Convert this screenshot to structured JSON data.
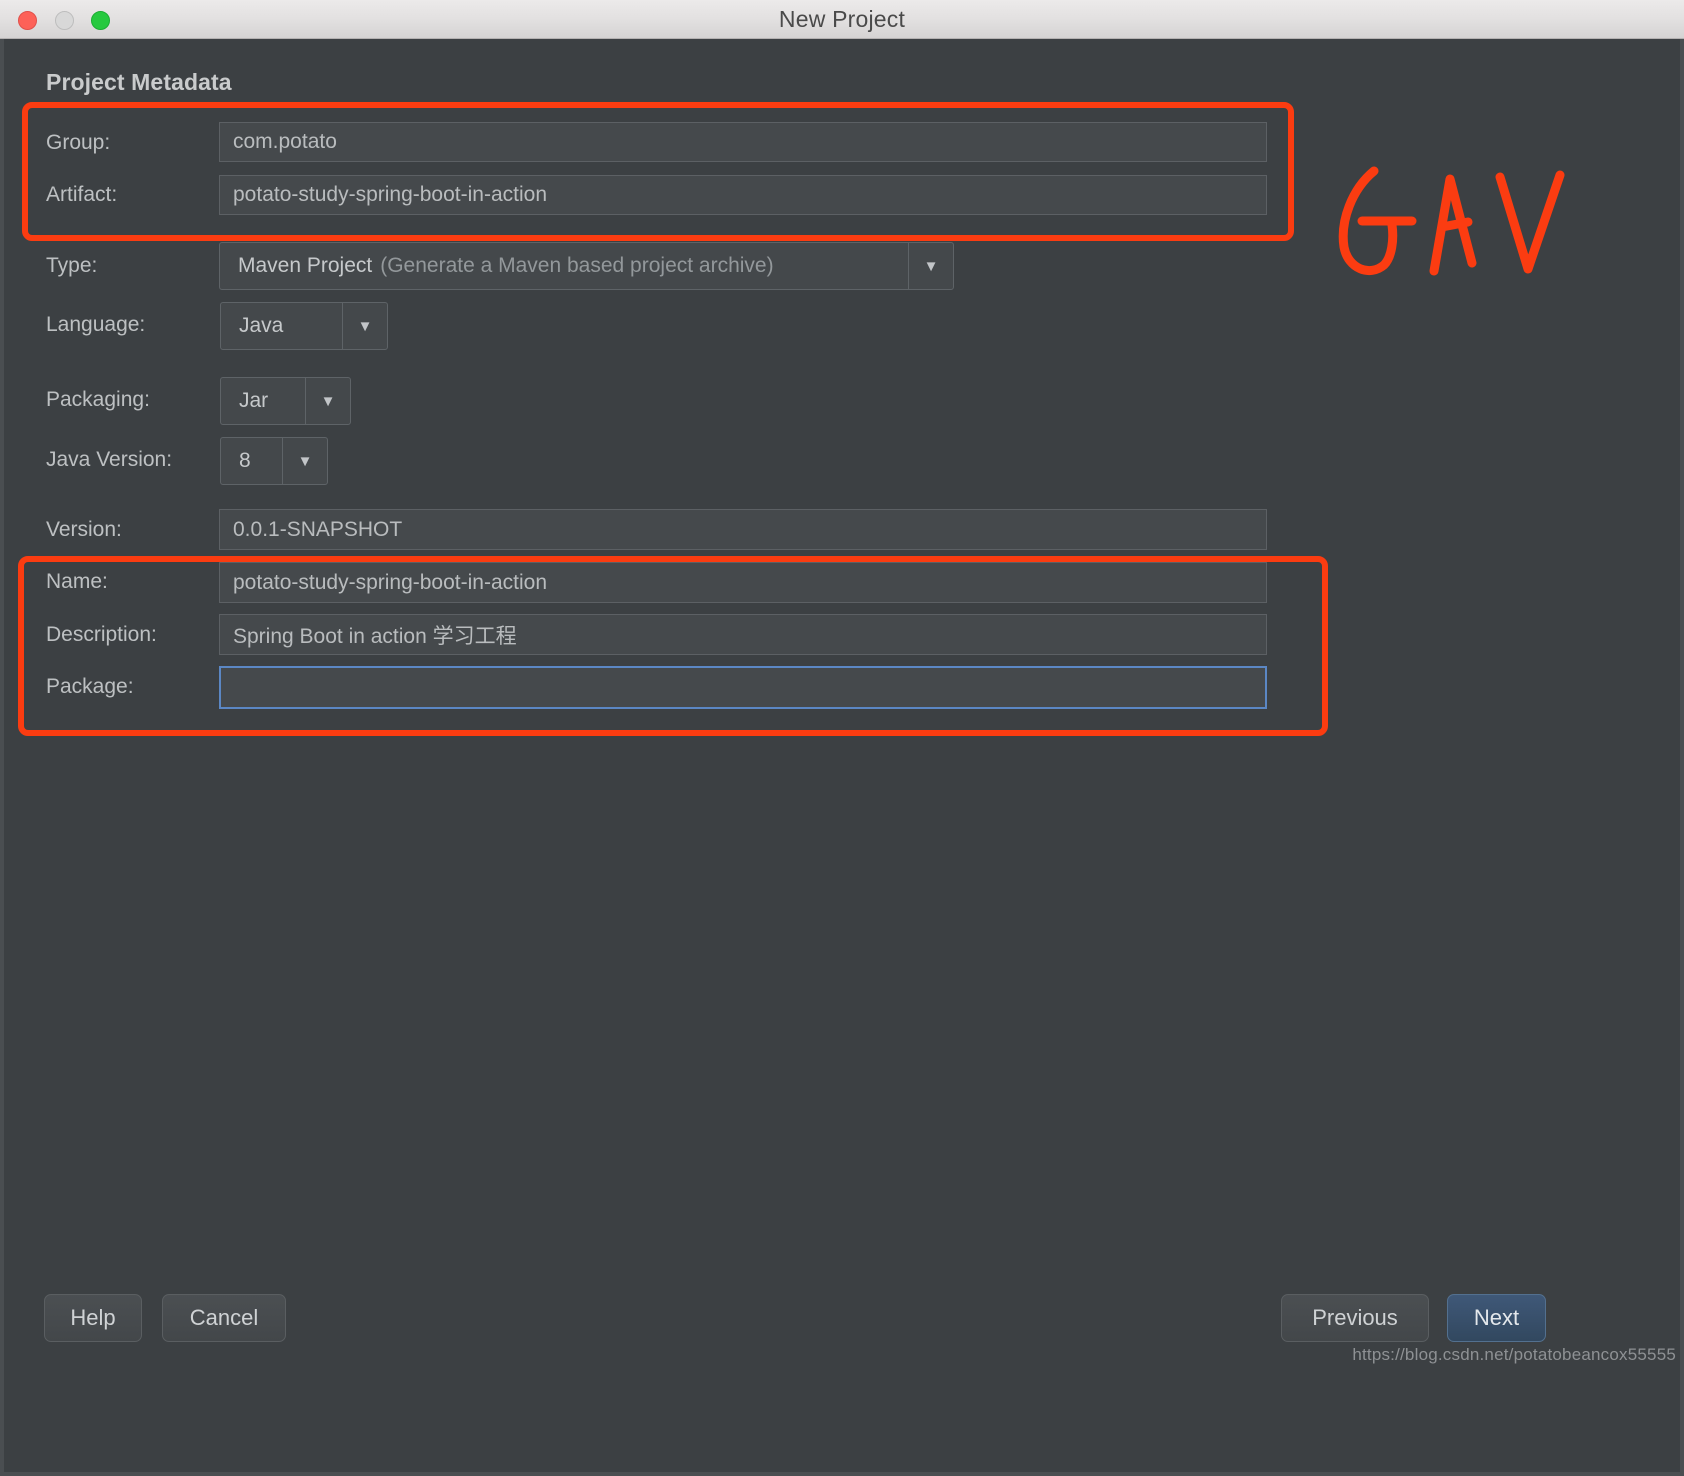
{
  "window": {
    "title": "New Project",
    "traffic_lights": [
      "close-button",
      "minimize-button",
      "maximize-button"
    ]
  },
  "section": {
    "title": "Project Metadata"
  },
  "fields": {
    "group": {
      "label": "Group:",
      "value": "com.potato",
      "placeholder": ""
    },
    "artifact": {
      "label": "Artifact:",
      "value": "potato-study-spring-boot-in-action",
      "placeholder": ""
    },
    "type": {
      "label": "Type:",
      "value": "Maven Project",
      "value_detail": "(Generate a Maven based project archive)",
      "arrow": "▼"
    },
    "language": {
      "label": "Language:",
      "value": "Java",
      "arrow": "▼"
    },
    "packaging": {
      "label": "Packaging:",
      "value": "Jar",
      "arrow": "▼"
    },
    "java_version": {
      "label": "Java Version:",
      "value": "8",
      "arrow": "▼"
    },
    "version": {
      "label": "Version:",
      "value": "0.0.1-SNAPSHOT",
      "placeholder": ""
    },
    "name": {
      "label": "Name:",
      "value": "potato-study-spring-boot-in-action",
      "placeholder": ""
    },
    "description": {
      "label": "Description:",
      "value": "Spring Boot in action 学习工程",
      "placeholder": ""
    },
    "package": {
      "label": "Package:",
      "value": "",
      "placeholder": ""
    }
  },
  "annotations": {
    "gav_label": "GAV",
    "color": "#fb3c11",
    "boxes": [
      {
        "name": "gav-highlight-box",
        "covers": [
          "group",
          "artifact"
        ]
      },
      {
        "name": "name-description-package-highlight-box",
        "covers": [
          "name",
          "description",
          "package"
        ]
      }
    ]
  },
  "footer": {
    "help_label": "Help",
    "cancel_label": "Cancel",
    "previous_label": "Previous",
    "next_label": "Next"
  },
  "watermark": {
    "text": "https://blog.csdn.net/potatobeancox55555"
  },
  "colors": {
    "dialog_background": "#3c4043",
    "field_background": "#45494c",
    "accent_red": "#fb3c11",
    "focus_blue": "#5b87c4",
    "primary_button": "#3f5878"
  }
}
